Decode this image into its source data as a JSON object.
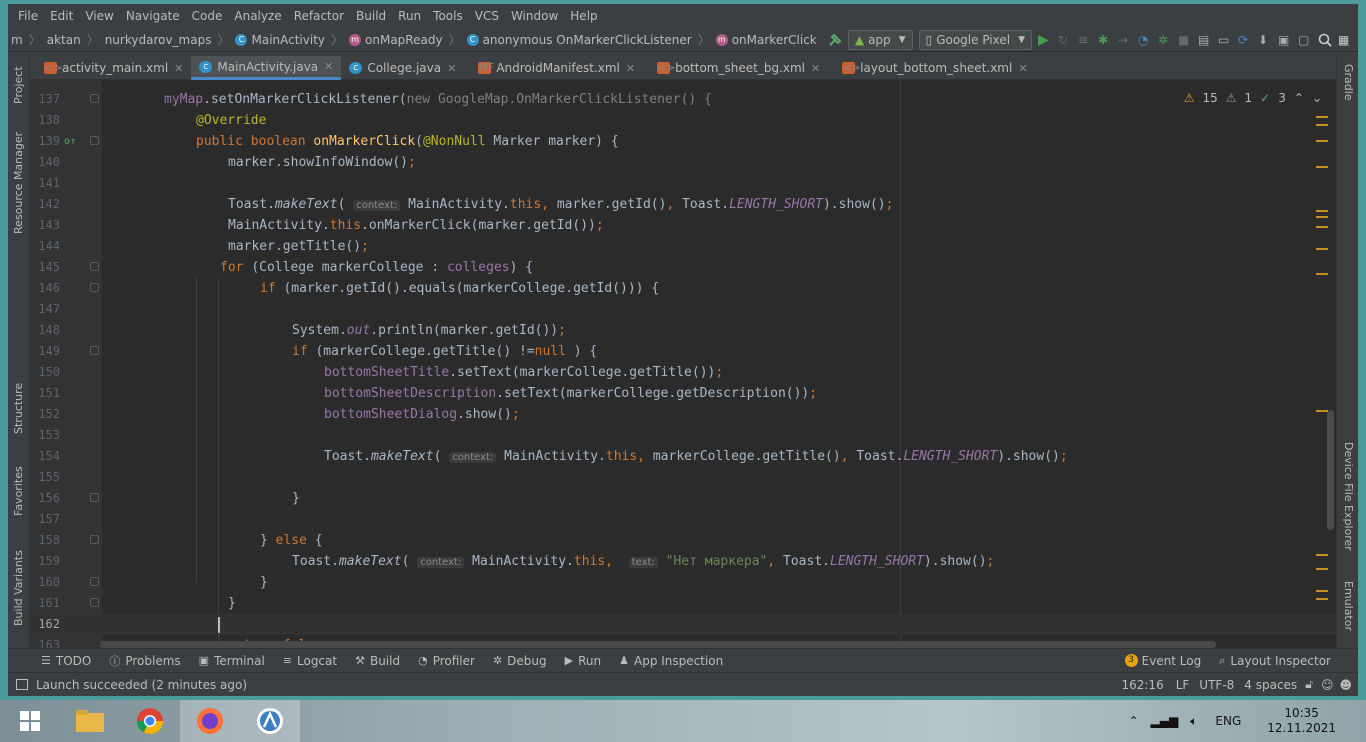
{
  "menu": [
    "File",
    "Edit",
    "View",
    "Navigate",
    "Code",
    "Analyze",
    "Refactor",
    "Build",
    "Run",
    "Tools",
    "VCS",
    "Window",
    "Help"
  ],
  "breadcrumbs": [
    "m",
    "aktan",
    "nurkydarov_maps",
    "MainActivity",
    "onMapReady",
    "anonymous OnMarkerClickListener",
    "onMarkerClick"
  ],
  "toolbar": {
    "config": "app",
    "device": "Google Pixel"
  },
  "tabs": [
    "activity_main.xml",
    "MainActivity.java",
    "College.java",
    "AndroidManifest.xml",
    "bottom_sheet_bg.xml",
    "layout_bottom_sheet.xml"
  ],
  "active_tab_index": 1,
  "left_tools": [
    "Project",
    "Resource Manager",
    "Structure",
    "Favorites",
    "Build Variants"
  ],
  "right_tools": [
    "Gradle",
    "Device File Explorer",
    "Emulator"
  ],
  "inspections": {
    "warnings": "15",
    "weak_warnings": "1",
    "typos": "3"
  },
  "code_lines": [
    {
      "n": "137"
    },
    {
      "n": "138"
    },
    {
      "n": "139"
    },
    {
      "n": "140"
    },
    {
      "n": "141"
    },
    {
      "n": "142"
    },
    {
      "n": "143"
    },
    {
      "n": "144"
    },
    {
      "n": "145"
    },
    {
      "n": "146"
    },
    {
      "n": "147"
    },
    {
      "n": "148"
    },
    {
      "n": "149"
    },
    {
      "n": "150"
    },
    {
      "n": "151"
    },
    {
      "n": "152"
    },
    {
      "n": "153"
    },
    {
      "n": "154"
    },
    {
      "n": "155"
    },
    {
      "n": "156"
    },
    {
      "n": "157"
    },
    {
      "n": "158"
    },
    {
      "n": "159"
    },
    {
      "n": "160"
    },
    {
      "n": "161"
    },
    {
      "n": "162"
    },
    {
      "n": "163"
    }
  ],
  "code": {
    "l137_a": "myMap",
    "l137_b": ".setOnMarkerClickListener(",
    "l137_c": "new ",
    "l137_d": "GoogleMap.OnMarkerClickListener() {",
    "l138": "@Override",
    "l139_a": "public boolean ",
    "l139_b": "onMarkerClick",
    "l139_c": "(",
    "l139_d": "@NonNull",
    "l139_e": " Marker marker) {",
    "l140_a": "marker.showInfoWindow()",
    "l140_b": ";",
    "l142_a": "Toast.",
    "l142_b": "makeText",
    "l142_c": "(",
    "l142_hint": "context:",
    "l142_d": " MainActivity.",
    "l142_e": "this",
    "l142_f": ", ",
    "l142_g": "marker.getId()",
    "l142_h": ", ",
    "l142_i": "Toast.",
    "l142_j": "LENGTH_SHORT",
    "l142_k": ").show()",
    "l142_l": ";",
    "l143_a": "MainActivity.",
    "l143_b": "this",
    "l143_c": ".onMarkerClick(marker.getId())",
    "l143_d": ";",
    "l144_a": "marker.getTitle()",
    "l144_b": ";",
    "l145_a": "for ",
    "l145_b": "(College markerCollege : ",
    "l145_c": "colleges",
    "l145_d": ") {",
    "l146_a": "if ",
    "l146_b": "(marker.getId().equals(markerCollege.getId())) {",
    "l148_a": "System.",
    "l148_b": "out",
    "l148_c": ".println(marker.getId())",
    "l148_d": ";",
    "l149_a": "if ",
    "l149_b": "(markerCollege.getTitle() !=",
    "l149_c": "null",
    "l149_d": " ) {",
    "l150_a": "bottomSheetTitle",
    "l150_b": ".setText(markerCollege.getTitle())",
    "l150_c": ";",
    "l151_a": "bottomSheetDescription",
    "l151_b": ".setText(markerCollege.getDescription())",
    "l151_c": ";",
    "l152_a": "bottomSheetDialog",
    "l152_b": ".show()",
    "l152_c": ";",
    "l154_a": "Toast.",
    "l154_b": "makeText",
    "l154_c": "(",
    "l154_hint": "context:",
    "l154_d": " MainActivity.",
    "l154_e": "this",
    "l154_f": ", ",
    "l154_g": "markerCollege.getTitle()",
    "l154_h": ", ",
    "l154_i": "Toast.",
    "l154_j": "LENGTH_SHORT",
    "l154_k": ").show()",
    "l154_l": ";",
    "l156": "}",
    "l158_a": "} ",
    "l158_b": "else ",
    "l158_c": "{",
    "l159_a": "Toast.",
    "l159_b": "makeText",
    "l159_c": "(",
    "l159_hint": "context:",
    "l159_d": " MainActivity.",
    "l159_e": "this",
    "l159_f": ", ",
    "l159_hint2": "text:",
    "l159_g": " \"Нет маркера\"",
    "l159_h": ", ",
    "l159_i": "Toast.",
    "l159_j": "LENGTH_SHORT",
    "l159_k": ").show()",
    "l159_l": ";",
    "l160": "}",
    "l161": "}",
    "l163_a": "return false",
    "l163_b": ";"
  },
  "bottom_tools": [
    "TODO",
    "Problems",
    "Terminal",
    "Logcat",
    "Build",
    "Profiler",
    "Debug",
    "Run",
    "App Inspection"
  ],
  "bottom_right": {
    "event_log_count": "3",
    "event_log": "Event Log",
    "layout_inspector": "Layout Inspector"
  },
  "status": {
    "message": "Launch succeeded (2 minutes ago)",
    "position": "162:16",
    "line_sep": "LF",
    "encoding": "UTF-8",
    "indent": "4 spaces"
  },
  "taskbar": {
    "lang": "ENG",
    "time": "10:35",
    "date": "12.11.2021"
  },
  "colors": {
    "ide_bg": "#3c3f41",
    "editor_bg": "#2b2b2b",
    "keyword": "#cc7832",
    "field": "#9876aa",
    "method": "#ffc66d",
    "annotation": "#bbb529",
    "string": "#6a8759"
  }
}
